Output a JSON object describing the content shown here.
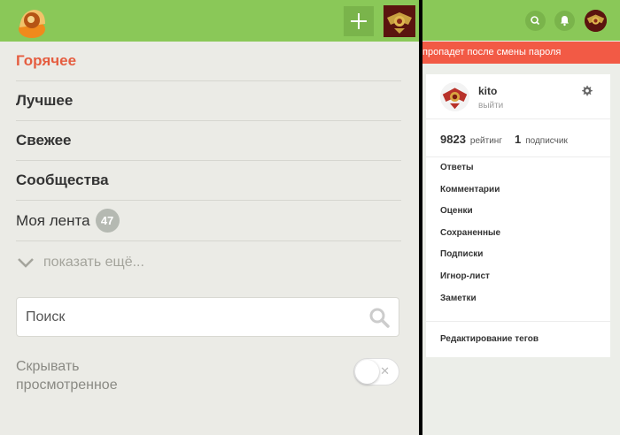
{
  "left_panel": {
    "menu": [
      {
        "label": "Горячее"
      },
      {
        "label": "Лучшее"
      },
      {
        "label": "Свежее"
      },
      {
        "label": "Сообщества"
      }
    ],
    "feed": {
      "label": "Моя лента",
      "count": "47"
    },
    "show_more": "показать ещё...",
    "search": {
      "placeholder": "Поиск"
    },
    "hide_viewed": {
      "line1": "Скрывать",
      "line2": "просмотренное",
      "enabled": false
    },
    "colors": {
      "header": "#8ac858",
      "accent": "#e55d40"
    }
  },
  "right_panel": {
    "alert_text": "пропадет после смены пароля",
    "profile": {
      "username": "kito",
      "logout": "выйти",
      "rating_value": "9823",
      "rating_label": "рейтинг",
      "subscribers_value": "1",
      "subscribers_label": "подписчик"
    },
    "links": [
      {
        "label": "Ответы"
      },
      {
        "label": "Комментарии"
      },
      {
        "label": "Оценки"
      },
      {
        "label": "Сохраненные"
      },
      {
        "label": "Подписки"
      },
      {
        "label": "Игнор-лист"
      },
      {
        "label": "Заметки"
      }
    ],
    "edit_tags": "Редактирование тегов"
  }
}
